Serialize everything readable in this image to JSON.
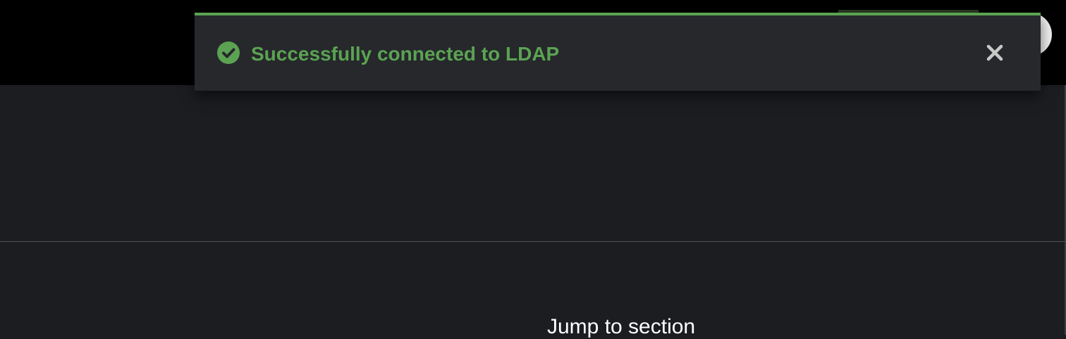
{
  "notification": {
    "type": "success",
    "title": "Successfully connected to LDAP",
    "icon": "check-circle-icon",
    "close_icon": "close-icon",
    "accent_color": "#5ba352"
  },
  "main": {
    "jump_to_section_label": "Jump to section"
  },
  "colors": {
    "masthead_background": "#000000",
    "page_background": "#1b1d21",
    "toast_background": "#26282c",
    "success": "#5ba352"
  }
}
